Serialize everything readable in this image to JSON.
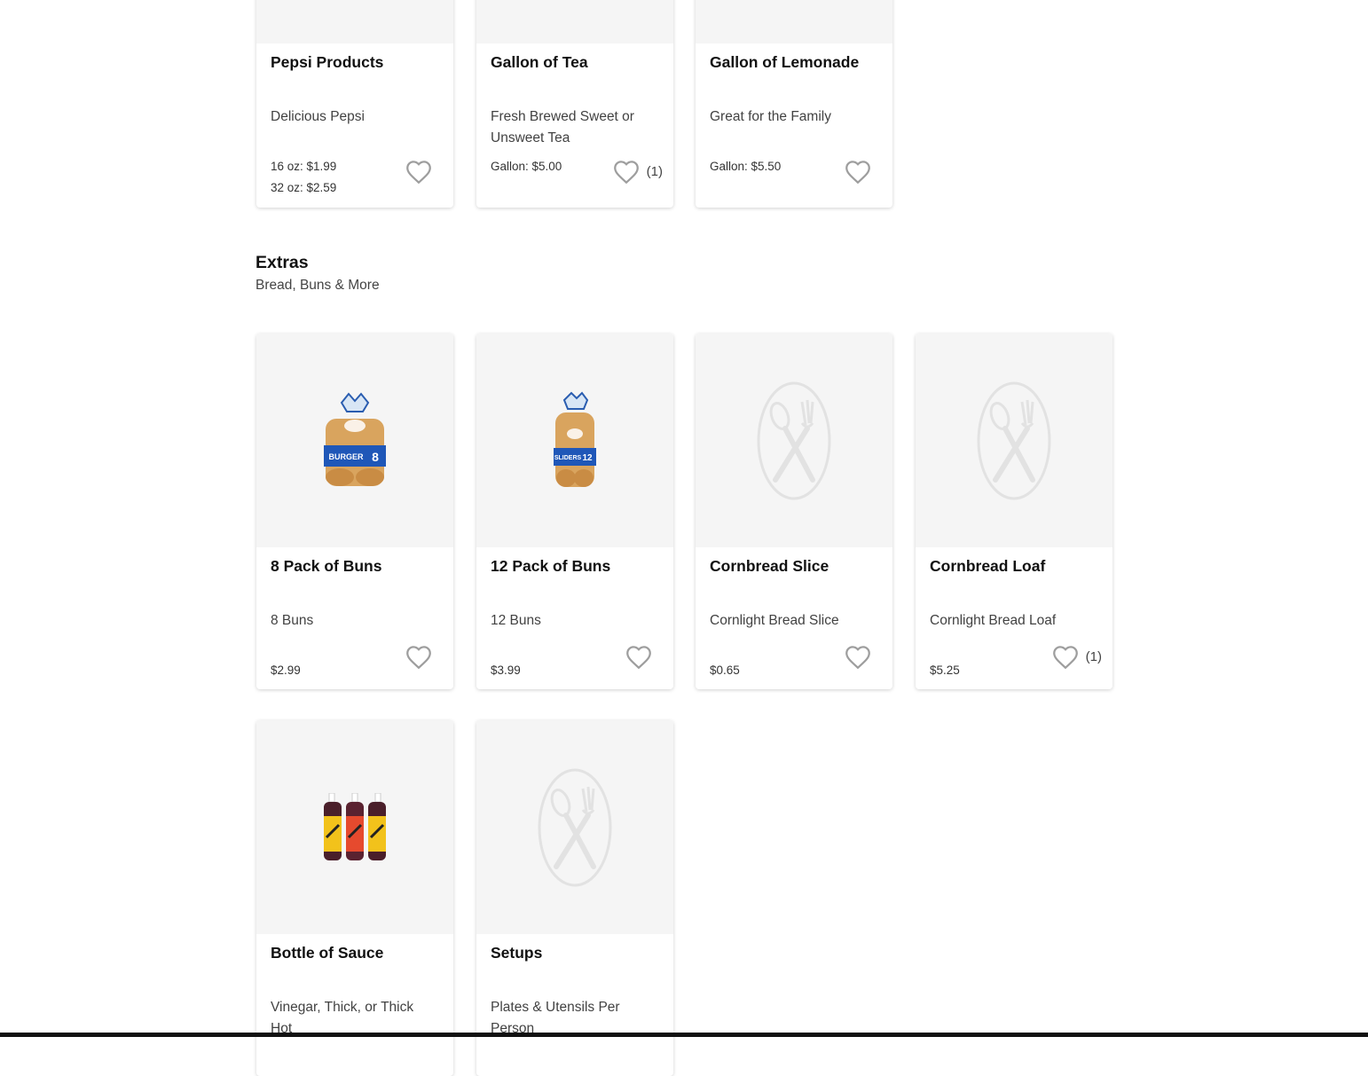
{
  "drinks": [
    {
      "title": "Pepsi Products",
      "desc": "Delicious Pepsi",
      "prices": [
        "16 oz: $1.99",
        "32 oz: $2.59"
      ],
      "fav_count": ""
    },
    {
      "title": "Gallon of Tea",
      "desc": "Fresh Brewed Sweet or Unsweet Tea",
      "prices": [
        "Gallon: $5.00"
      ],
      "fav_count": "(1)"
    },
    {
      "title": "Gallon of Lemonade",
      "desc": "Great for the Family",
      "prices": [
        "Gallon: $5.50"
      ],
      "fav_count": ""
    }
  ],
  "extras_section": {
    "title": "Extras",
    "subtitle": "Bread, Buns & More"
  },
  "extras": [
    {
      "title": "8 Pack of Buns",
      "desc": "8 Buns",
      "prices": [
        "$2.99"
      ],
      "fav_count": "",
      "image": "burger-buns-photo",
      "pack_label": "BURGER",
      "pack_count": "8"
    },
    {
      "title": "12 Pack of Buns",
      "desc": "12 Buns",
      "prices": [
        "$3.99"
      ],
      "fav_count": "",
      "image": "slider-buns-photo",
      "pack_label": "SLIDERS",
      "pack_count": "12"
    },
    {
      "title": "Cornbread Slice",
      "desc": "Cornlight Bread Slice",
      "prices": [
        "$0.65"
      ],
      "fav_count": "",
      "image": "placeholder-utensils-icon"
    },
    {
      "title": "Cornbread Loaf",
      "desc": "Cornlight Bread Loaf",
      "prices": [
        "$5.25"
      ],
      "fav_count": "(1)",
      "image": "placeholder-utensils-icon"
    },
    {
      "title": "Bottle of Sauce",
      "desc": "Vinegar, Thick, or Thick Hot",
      "prices": [],
      "fav_count": "",
      "image": "sauce-bottles-photo"
    },
    {
      "title": "Setups",
      "desc": "Plates & Utensils Per Person",
      "prices": [],
      "fav_count": "",
      "image": "placeholder-utensils-icon"
    }
  ],
  "colors": {
    "heart": "#9e9e9e",
    "image_bg": "#f5f5f5",
    "placeholder": "#e2e2e2"
  }
}
